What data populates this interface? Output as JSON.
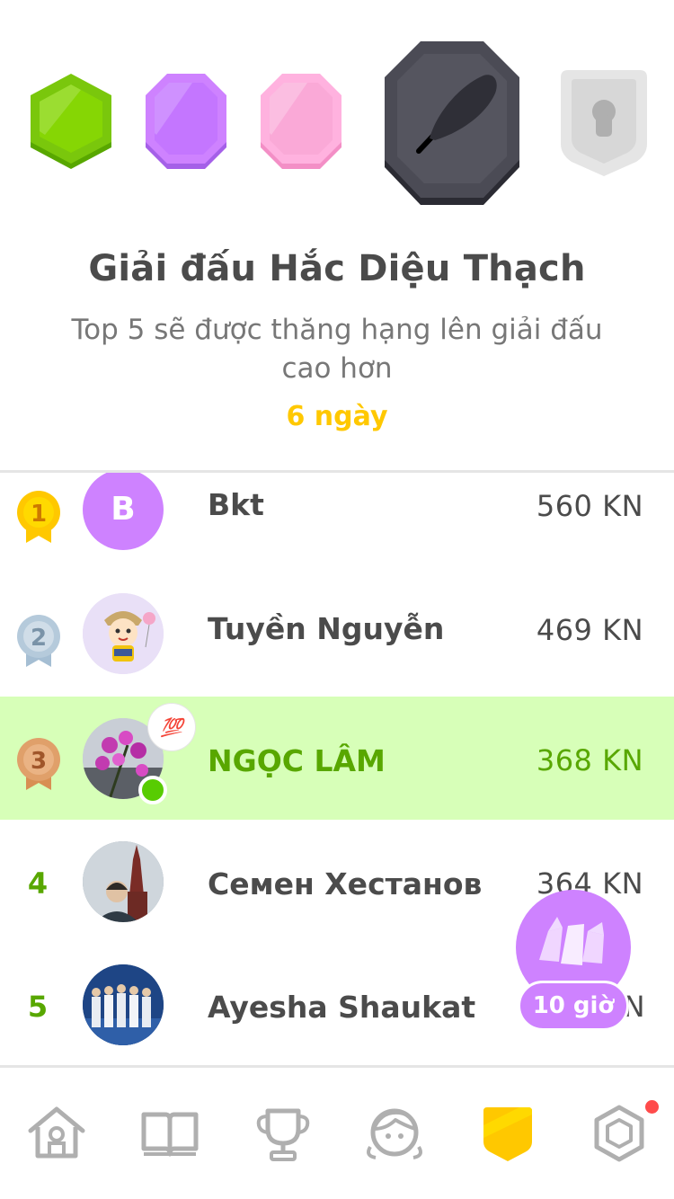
{
  "league": {
    "title": "Giải đấu Hắc Diệu Thạch",
    "subtitle": "Top 5 sẽ được thăng hạng lên giải đấu cao hơn",
    "time_left": "6 ngày",
    "badges": [
      {
        "name": "emerald",
        "color": "#7ac70c"
      },
      {
        "name": "amethyst",
        "color": "#ce82ff"
      },
      {
        "name": "pearl",
        "color": "#ffb2df"
      },
      {
        "name": "obsidian",
        "color": "#4b4b55",
        "current": true
      },
      {
        "name": "diamond",
        "color": "#e5e5e5",
        "locked": true
      }
    ]
  },
  "leaderboard": [
    {
      "rank": "1",
      "name": "Bkt",
      "xp": "560 KN",
      "avatar_letter": "B",
      "medal": "gold"
    },
    {
      "rank": "2",
      "name": "Tuyền Nguyễn",
      "xp": "469 KN",
      "medal": "silver"
    },
    {
      "rank": "3",
      "name": "NGỌC LÂM",
      "xp": "368 KN",
      "medal": "bronze",
      "is_me": true,
      "emoji": "💯",
      "online": true
    },
    {
      "rank": "4",
      "name": "Семен Хестанов",
      "xp": "364 KN"
    },
    {
      "rank": "5",
      "name": "Ayesha Shaukat",
      "xp": "N"
    }
  ],
  "chest": {
    "time_label": "10 giờ"
  },
  "colors": {
    "accent_green": "#58a700",
    "highlight_row": "#d7ffb8",
    "timer_yellow": "#ffc800",
    "purple": "#ce82ff",
    "notification": "#ff4b4b"
  },
  "nav": [
    "home-icon",
    "book-icon",
    "trophy-icon",
    "character-icon",
    "league-shield-icon",
    "gem-icon"
  ]
}
